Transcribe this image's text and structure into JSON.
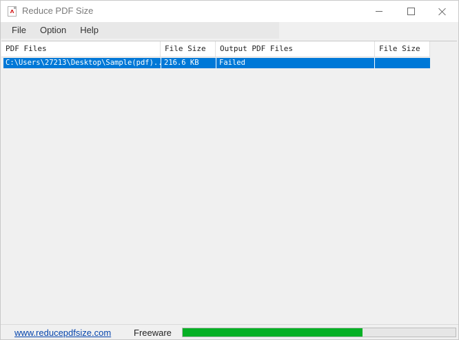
{
  "window": {
    "title": "Reduce PDF Size"
  },
  "menu": {
    "items": [
      {
        "label": "File"
      },
      {
        "label": "Option"
      },
      {
        "label": "Help"
      }
    ]
  },
  "list": {
    "columns": [
      "PDF Files",
      "File Size",
      "Output PDF Files",
      "File Size"
    ],
    "rows": [
      {
        "pdf_file": "C:\\Users\\27213\\Desktop\\Sample(pdf)...",
        "file_size": "216.6 KB",
        "output_pdf_file": "Failed",
        "output_file_size": "",
        "selected": true
      }
    ]
  },
  "statusbar": {
    "link": "www.reducepdfsize.com",
    "license": "Freeware",
    "progress": 0.66
  },
  "colors": {
    "selection": "#0078d7",
    "progress_fill": "#06b025",
    "link": "#0645ad"
  }
}
